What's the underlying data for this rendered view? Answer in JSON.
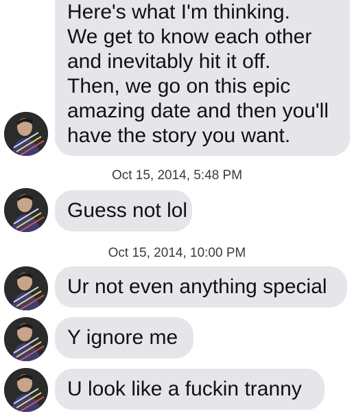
{
  "messages": [
    {
      "lines": [
        "Here's what I'm thinking.",
        "We get to know each other",
        "and inevitably hit it off.",
        "Then, we go on this epic",
        "amazing date and then you'll",
        "have the story you want."
      ]
    },
    {
      "text": "Guess not lol"
    },
    {
      "text": "Ur not even anything special"
    },
    {
      "text": "Y ignore me"
    },
    {
      "text": "U look like a fuckin tranny"
    }
  ],
  "timestamps": [
    "Oct 15, 2014, 5:48 PM",
    "Oct 15, 2014, 10:00 PM"
  ],
  "colors": {
    "bubble": "#e5e5ea",
    "text": "#111111",
    "timestamp": "#3a3a3c"
  },
  "icons": {
    "avatar": "contact-avatar-photo"
  }
}
